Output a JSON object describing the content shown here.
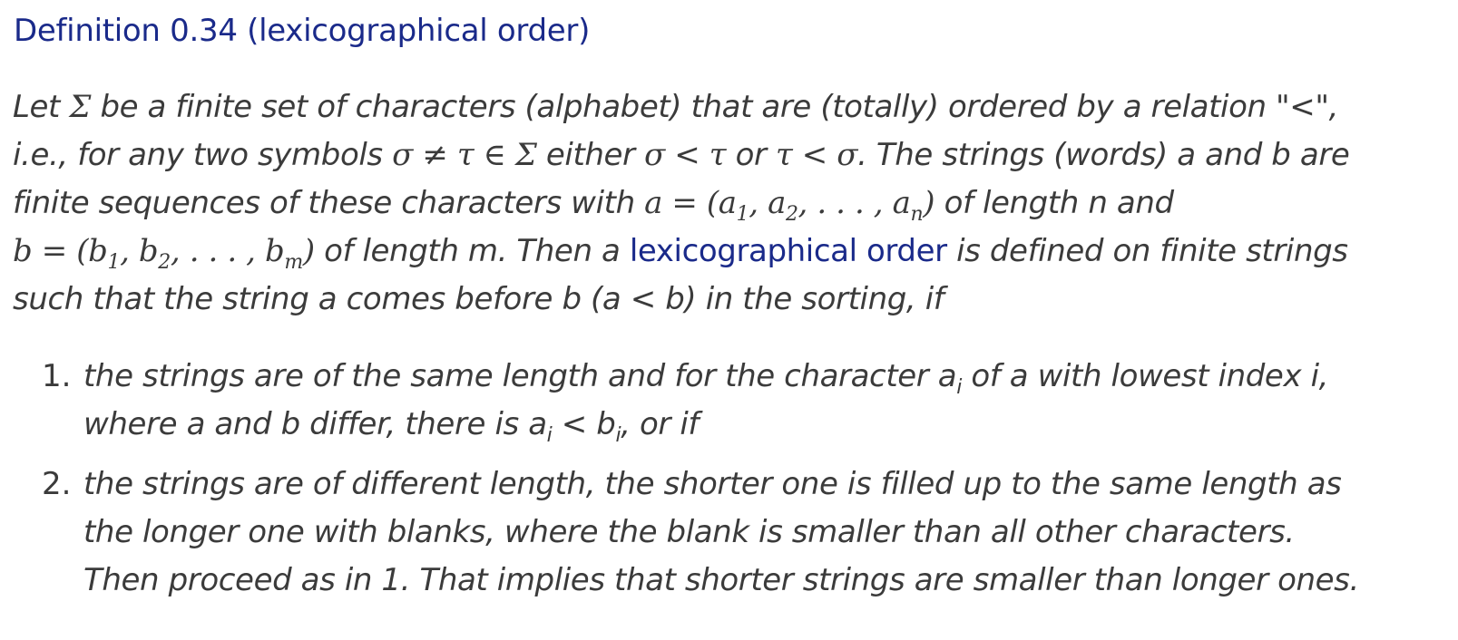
{
  "heading": "Definition 0.34 (lexicographical order)",
  "body": {
    "line1": {
      "a": "Let ",
      "sigma": "Σ",
      "b": " be a finite set of characters (alphabet) that are (totally) ordered by a relation \"<\","
    },
    "line2": {
      "a": "i.e., for any two symbols ",
      "m1": "σ ≠ τ ∈ Σ",
      "b": " either ",
      "m2": "σ < τ",
      "c": " or ",
      "m3": "τ < σ",
      "d": ". The strings (words) a and b are"
    },
    "line3": {
      "a": "finite sequences of these characters with ",
      "m1": "a = (a",
      "s1": "1",
      "m2": ", a",
      "s2": "2",
      "m3": ", . . . , a",
      "s3": "n",
      "m4": ")",
      "b": " of length n and"
    },
    "line4": {
      "m1": "b = (b",
      "s1": "1",
      "m2": ", b",
      "s2": "2",
      "m3": ", . . . , b",
      "s3": "m",
      "m4": ")",
      "a": " of length m. Then a ",
      "term": "lexicographical order",
      "b": " is defined on finite strings"
    },
    "line5": "such that the string a comes before b (a < b) in the sorting, if"
  },
  "list": [
    {
      "number": "1.",
      "line1": {
        "a": "the strings are of the same length and for the character a",
        "s": "i",
        "b": " of a with lowest index i,"
      },
      "line2": {
        "a": "where a and b differ, there is a",
        "s1": "i",
        "m": " < b",
        "s2": "i",
        "b": ", or if"
      }
    },
    {
      "number": "2.",
      "line1": "the strings are of different length, the shorter one is filled up to the same length as",
      "line2": "the longer one with blanks, where the blank is smaller than all other characters.",
      "line3": "Then proceed as in 1. That implies that shorter strings are smaller than longer ones."
    }
  ]
}
